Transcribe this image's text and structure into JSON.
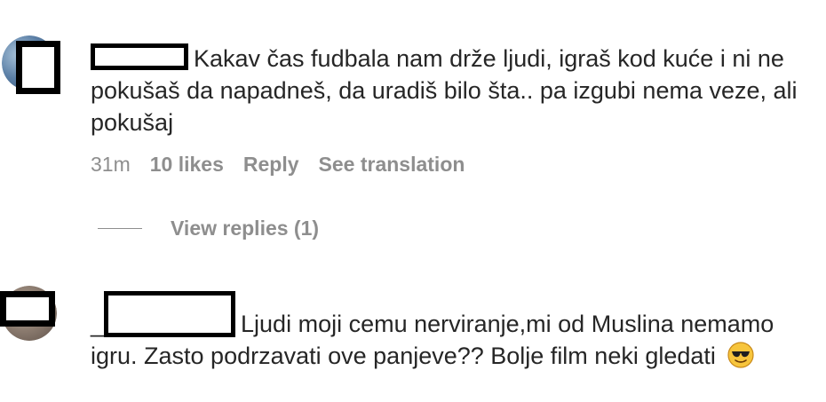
{
  "comments": [
    {
      "text": "Kakav čas fudbala nam drže ljudi, igraš kod kuće i ni ne pokušaš da napadneš, da uradiš bilo šta.. pa izgubi nema veze, ali pokušaj",
      "time": "31m",
      "likes": "10 likes",
      "reply": "Reply",
      "translate": "See translation",
      "view_replies": "View replies (1)"
    },
    {
      "text": "Ljudi moji cemu nerviranje,mi od Muslina nemamo igru. Zasto podrzavati ove panjeve?? Bolje film neki gledati",
      "prefix": "_",
      "emoji": "smiling-face-with-sunglasses"
    }
  ],
  "colors": {
    "text": "#262626",
    "secondary": "#8e8e8e",
    "redaction": "#000000",
    "emoji_face": "#f7c53c"
  }
}
